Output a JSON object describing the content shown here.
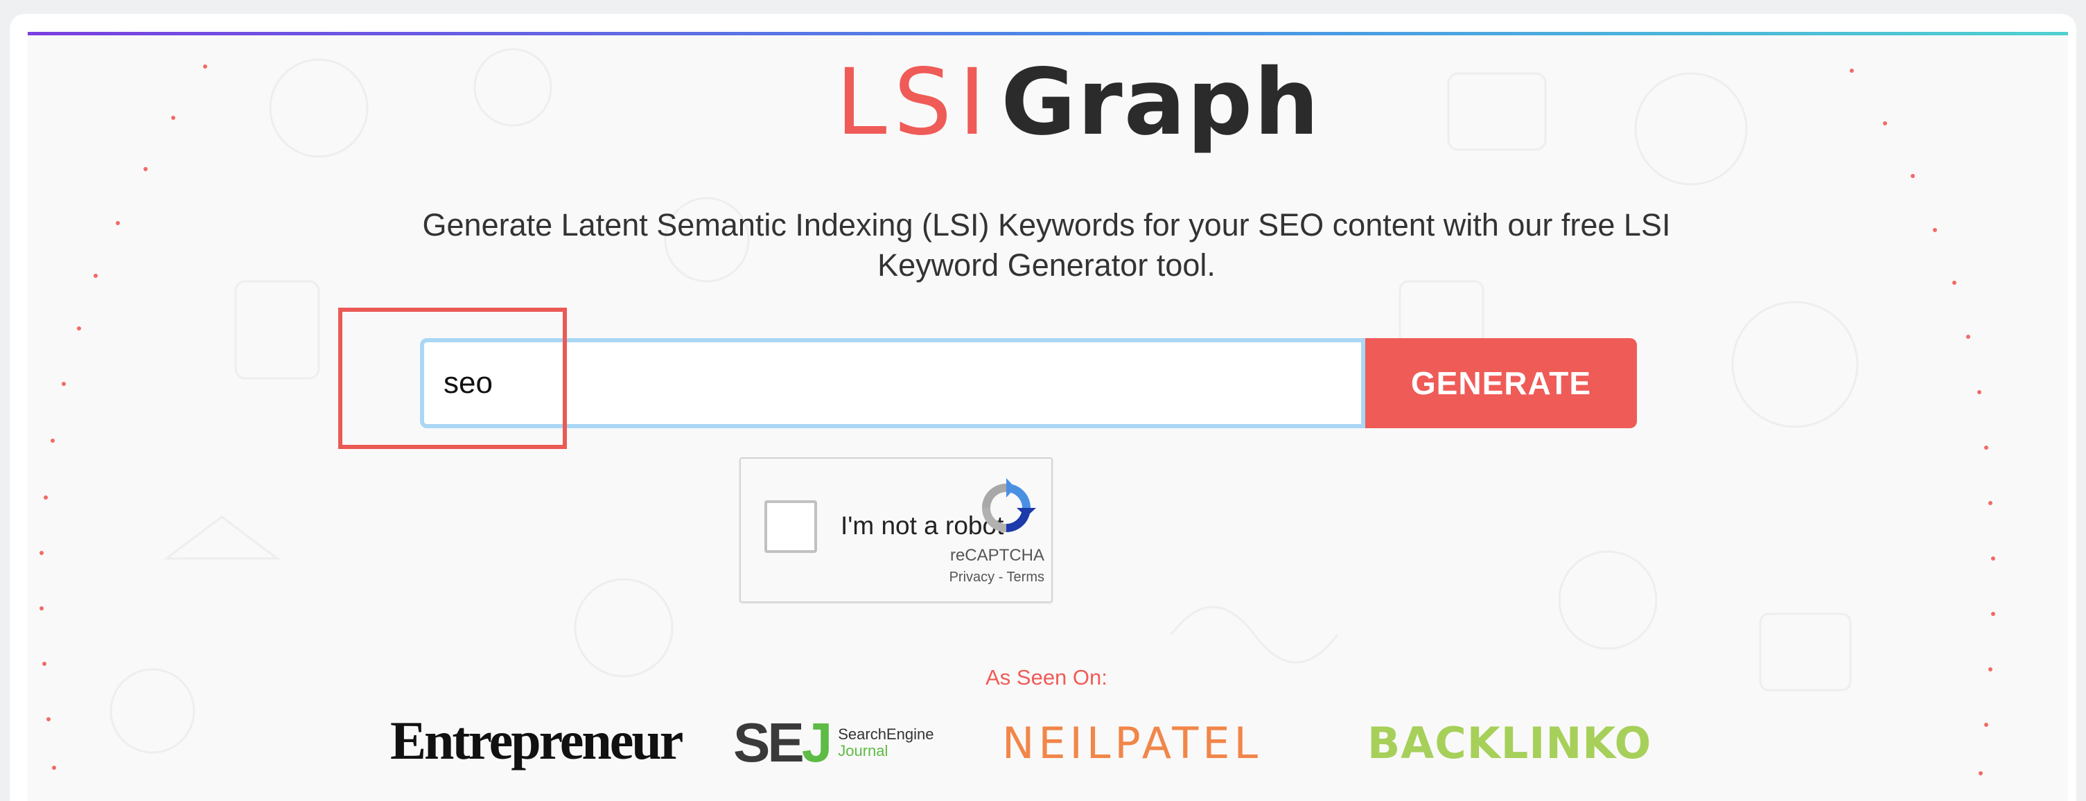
{
  "logo": {
    "part1": "LSI",
    "part2": "Graph"
  },
  "tagline": "Generate Latent Semantic Indexing (LSI) Keywords for your SEO content with our free LSI Keyword Generator tool.",
  "search": {
    "value": "seo",
    "button_label": "GENERATE"
  },
  "captcha": {
    "label": "I'm not a robot",
    "brand": "reCAPTCHA",
    "links": "Privacy - Terms"
  },
  "seen_on": {
    "heading": "As Seen On:",
    "logos": [
      "Entrepreneur",
      "SEJ",
      "SearchEngine",
      "Journal",
      "NEILPATEL",
      "BACKLINKO"
    ]
  },
  "colors": {
    "accent": "#ef5b57",
    "highlight": "#ea5a55",
    "neilpatel": "#f18649",
    "backlinko": "#a6d05a",
    "sej_green": "#5dbb46"
  }
}
